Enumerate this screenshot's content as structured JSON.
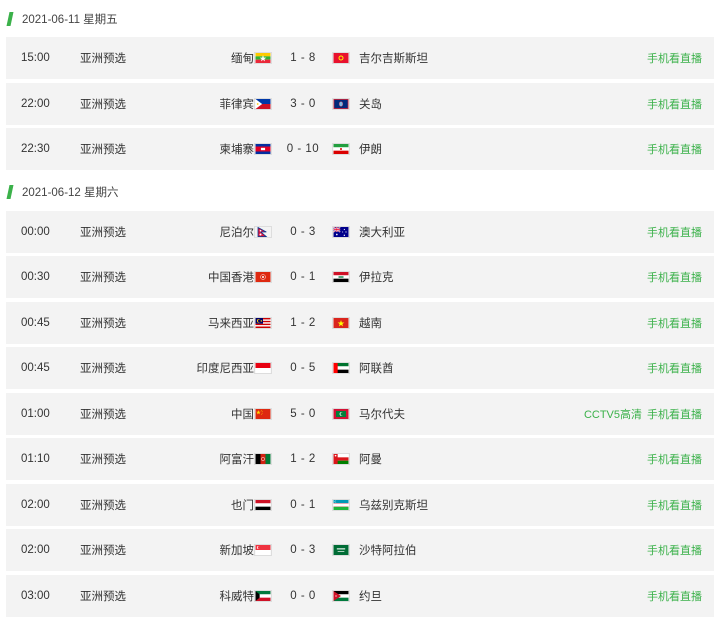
{
  "days": [
    {
      "date": "2021-06-11 星期五",
      "matches": [
        {
          "time": "15:00",
          "league": "亚洲预选",
          "home": "缅甸",
          "home_flag": "myanmar",
          "score": "1 - 8",
          "away": "吉尔吉斯斯坦",
          "away_flag": "kyrgyzstan",
          "extra": "",
          "watch": "手机看直播"
        },
        {
          "time": "22:00",
          "league": "亚洲预选",
          "home": "菲律宾",
          "home_flag": "philippines",
          "score": "3 - 0",
          "away": "关岛",
          "away_flag": "guam",
          "extra": "",
          "watch": "手机看直播"
        },
        {
          "time": "22:30",
          "league": "亚洲预选",
          "home": "柬埔寨",
          "home_flag": "cambodia",
          "score": "0 - 10",
          "away": "伊朗",
          "away_flag": "iran",
          "extra": "",
          "watch": "手机看直播"
        }
      ]
    },
    {
      "date": "2021-06-12 星期六",
      "matches": [
        {
          "time": "00:00",
          "league": "亚洲预选",
          "home": "尼泊尔",
          "home_flag": "nepal",
          "score": "0 - 3",
          "away": "澳大利亚",
          "away_flag": "australia",
          "extra": "",
          "watch": "手机看直播"
        },
        {
          "time": "00:30",
          "league": "亚洲预选",
          "home": "中国香港",
          "home_flag": "hongkong",
          "score": "0 - 1",
          "away": "伊拉克",
          "away_flag": "iraq",
          "extra": "",
          "watch": "手机看直播"
        },
        {
          "time": "00:45",
          "league": "亚洲预选",
          "home": "马来西亚",
          "home_flag": "malaysia",
          "score": "1 - 2",
          "away": "越南",
          "away_flag": "vietnam",
          "extra": "",
          "watch": "手机看直播"
        },
        {
          "time": "00:45",
          "league": "亚洲预选",
          "home": "印度尼西亚",
          "home_flag": "indonesia",
          "score": "0 - 5",
          "away": "阿联酋",
          "away_flag": "uae",
          "extra": "",
          "watch": "手机看直播"
        },
        {
          "time": "01:00",
          "league": "亚洲预选",
          "home": "中国",
          "home_flag": "china",
          "score": "5 - 0",
          "away": "马尔代夫",
          "away_flag": "maldives",
          "extra": "CCTV5高清",
          "watch": "手机看直播"
        },
        {
          "time": "01:10",
          "league": "亚洲预选",
          "home": "阿富汗",
          "home_flag": "afghanistan",
          "score": "1 - 2",
          "away": "阿曼",
          "away_flag": "oman",
          "extra": "",
          "watch": "手机看直播"
        },
        {
          "time": "02:00",
          "league": "亚洲预选",
          "home": "也门",
          "home_flag": "yemen",
          "score": "0 - 1",
          "away": "乌兹别克斯坦",
          "away_flag": "uzbekistan",
          "extra": "",
          "watch": "手机看直播"
        },
        {
          "time": "02:00",
          "league": "亚洲预选",
          "home": "新加坡",
          "home_flag": "singapore",
          "score": "0 - 3",
          "away": "沙特阿拉伯",
          "away_flag": "saudi",
          "extra": "",
          "watch": "手机看直播"
        },
        {
          "time": "03:00",
          "league": "亚洲预选",
          "home": "科威特",
          "home_flag": "kuwait",
          "score": "0 - 0",
          "away": "约旦",
          "away_flag": "jordan",
          "extra": "",
          "watch": "手机看直播"
        }
      ]
    }
  ],
  "colors": {
    "accent": "#3bb14a",
    "row_bg": "#f3f3f3"
  }
}
